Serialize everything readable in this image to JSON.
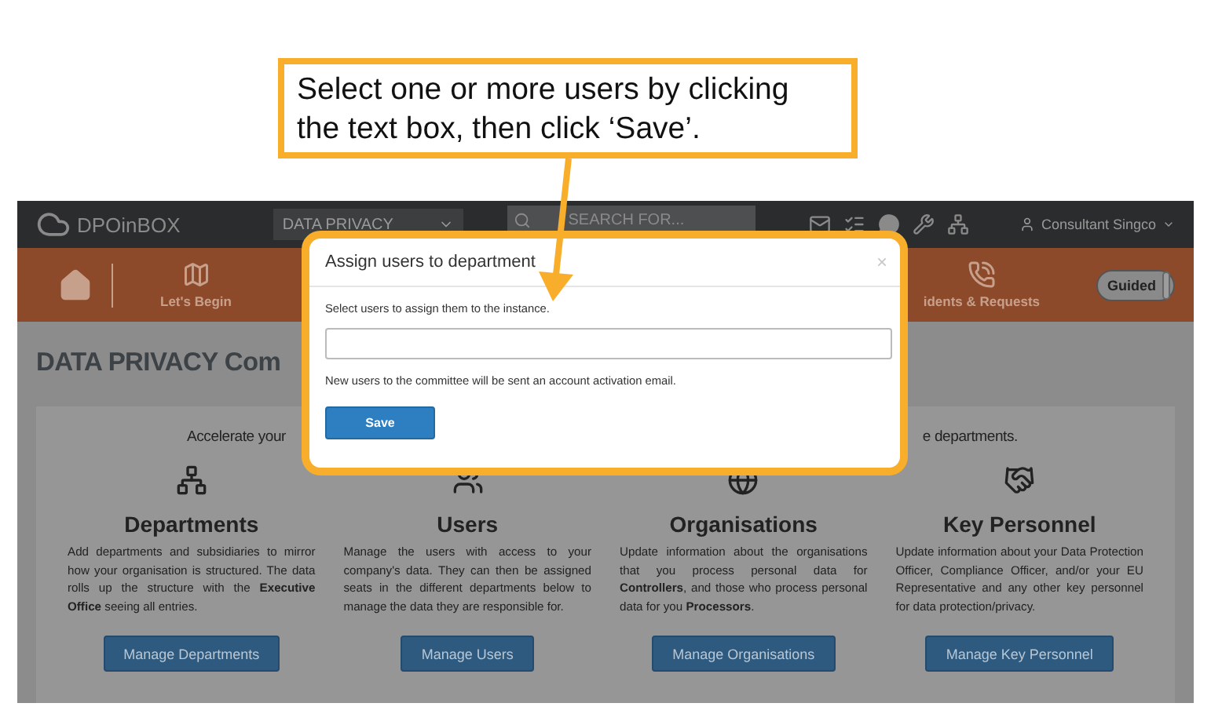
{
  "callout": {
    "text": "Select one or more users by clicking the text box, then click ‘Save’."
  },
  "header": {
    "logo": "DPOinBOX",
    "workspace_select": "DATA PRIVACY",
    "search": {
      "placeholder": "SEARCH FOR..."
    },
    "user": "Consultant Singco"
  },
  "nav": {
    "items": [
      {
        "label": "Let's Begin",
        "kind": "begin"
      },
      {
        "label": "idents & Requests",
        "kind": "incidents"
      }
    ],
    "guided": {
      "label": "Guided",
      "on": true
    }
  },
  "page_title": "DATA PRIVACY Com",
  "intro": [
    "Accelerate your",
    "e departments."
  ],
  "cards": [
    {
      "title": "Departments",
      "kind": "departments",
      "description": "Add departments and subsidiaries to mirror how your organisation is structured. The data rolls up the structure with the **Executive Office** seeing all entries.",
      "button": "Manage Departments"
    },
    {
      "title": "Users",
      "kind": "users",
      "description": "Manage the users with access to your company's data. They can then be assigned seats in the different departments below to manage the data they are responsible for.",
      "button": "Manage Users"
    },
    {
      "title": "Organisations",
      "kind": "organisations",
      "description": "Update information about the organisations that you process personal data for **Controllers**, and those who process personal data for you **Processors**.",
      "button": "Manage Organisations"
    },
    {
      "title": "Key Personnel",
      "kind": "personnel",
      "description": "Update information about your Data Protection Officer, Compliance Officer, and/or your EU Representative and any other key personnel for data protection/privacy.",
      "button": "Manage Key Personnel"
    }
  ],
  "modal": {
    "title": "Assign users to department",
    "close": "×",
    "instruction": "Select users to assign them to the instance.",
    "note": "New users to the committee will be sent an account activation email.",
    "save": "Save"
  }
}
